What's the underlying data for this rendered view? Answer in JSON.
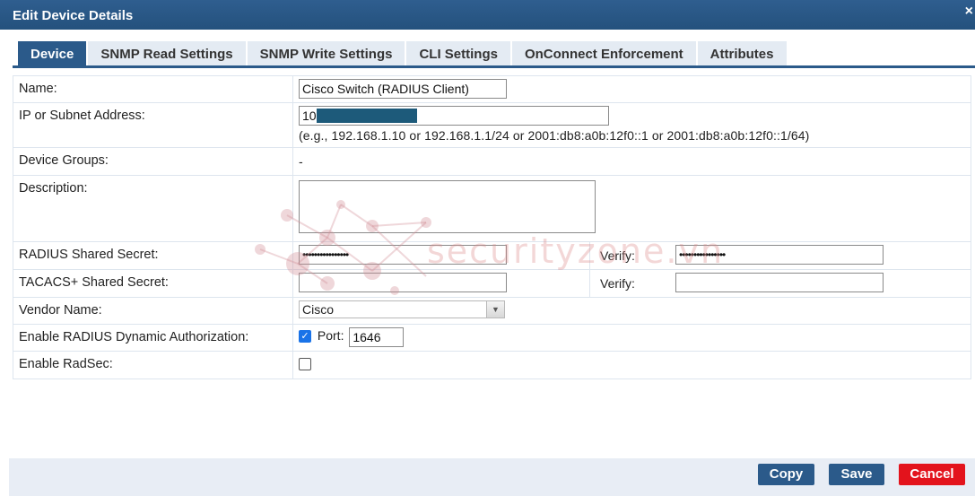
{
  "window": {
    "title": "Edit Device Details",
    "close_glyph": "×"
  },
  "tabs": [
    {
      "label": "Device",
      "active": true
    },
    {
      "label": "SNMP Read Settings",
      "active": false
    },
    {
      "label": "SNMP Write Settings",
      "active": false
    },
    {
      "label": "CLI Settings",
      "active": false
    },
    {
      "label": "OnConnect Enforcement",
      "active": false
    },
    {
      "label": "Attributes",
      "active": false
    }
  ],
  "form": {
    "name": {
      "label": "Name:",
      "value": "Cisco Switch (RADIUS Client)"
    },
    "ip": {
      "label": "IP or Subnet Address:",
      "value_prefix": "10",
      "hint": "(e.g., 192.168.1.10 or 192.168.1.1/24 or 2001:db8:a0b:12f0::1 or 2001:db8:a0b:12f0::1/64)"
    },
    "device_groups": {
      "label": "Device Groups:",
      "value": "-"
    },
    "description": {
      "label": "Description:",
      "value": ""
    },
    "radius_secret": {
      "label": "RADIUS Shared Secret:",
      "value": "••••••••••••••••",
      "verify_label": "Verify:",
      "verify_value": "••••••••••••••••"
    },
    "tacacs_secret": {
      "label": "TACACS+ Shared Secret:",
      "value": "",
      "verify_label": "Verify:",
      "verify_value": ""
    },
    "vendor": {
      "label": "Vendor Name:",
      "value": "Cisco"
    },
    "radius_dynamic": {
      "label": "Enable RADIUS Dynamic Authorization:",
      "checked": true,
      "port_label": "Port:",
      "port_value": "1646"
    },
    "radsec": {
      "label": "Enable RadSec:",
      "checked": false
    }
  },
  "watermark": {
    "text": "securityzone.vn"
  },
  "buttons": {
    "copy": "Copy",
    "save": "Save",
    "cancel": "Cancel"
  },
  "colors": {
    "header": "#2b5a8a",
    "tab_inactive": "#e4ebf3",
    "cancel": "#e3131c",
    "footer": "#e8edf5"
  }
}
